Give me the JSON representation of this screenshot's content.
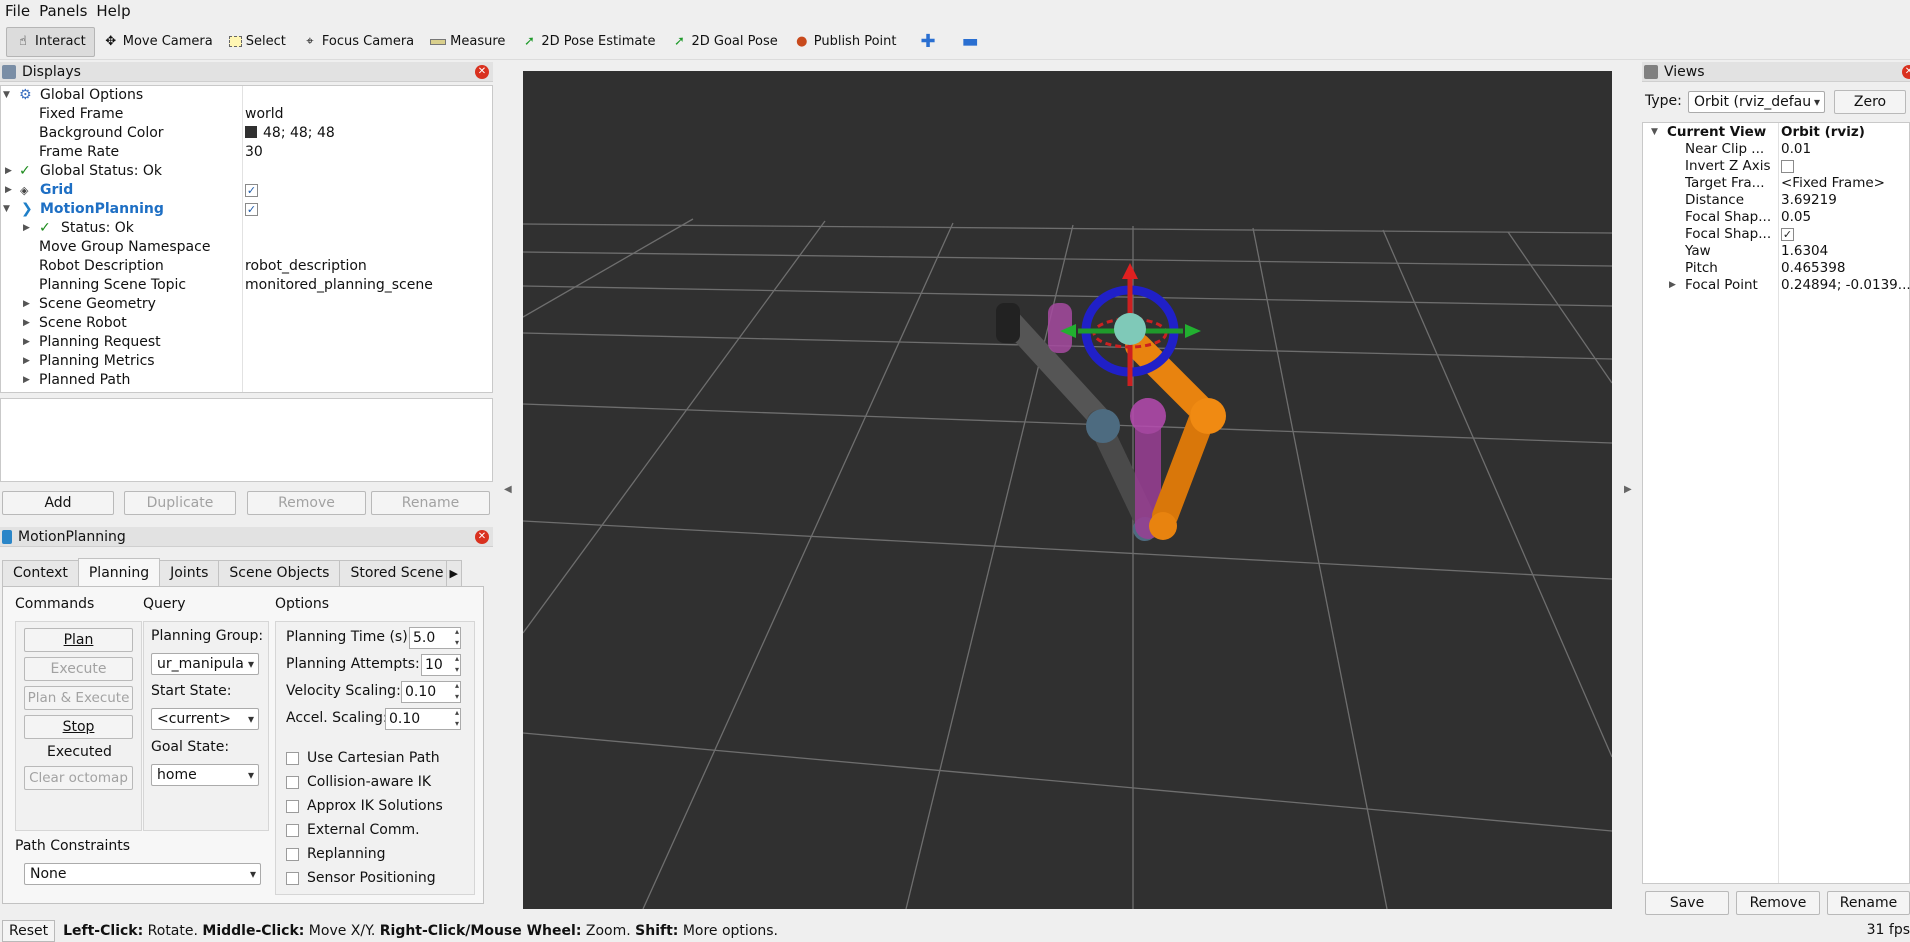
{
  "menu": {
    "file": "File",
    "panels": "Panels",
    "help": "Help"
  },
  "toolbar": {
    "interact": "Interact",
    "move_camera": "Move Camera",
    "select": "Select",
    "focus_camera": "Focus Camera",
    "measure": "Measure",
    "pose_estimate": "2D Pose Estimate",
    "goal_pose": "2D Goal Pose",
    "publish_point": "Publish Point"
  },
  "displays": {
    "title": "Displays",
    "rows": [
      {
        "label": "Global Options",
        "value": ""
      },
      {
        "label": "Fixed Frame",
        "value": "world"
      },
      {
        "label": "Background Color",
        "value": "48; 48; 48"
      },
      {
        "label": "Frame Rate",
        "value": "30"
      },
      {
        "label": "Global Status: Ok",
        "value": ""
      },
      {
        "label": "Grid",
        "value": ""
      },
      {
        "label": "MotionPlanning",
        "value": ""
      },
      {
        "label": "Status: Ok",
        "value": ""
      },
      {
        "label": "Move Group Namespace",
        "value": ""
      },
      {
        "label": "Robot Description",
        "value": "robot_description"
      },
      {
        "label": "Planning Scene Topic",
        "value": "monitored_planning_scene"
      },
      {
        "label": "Scene Geometry",
        "value": ""
      },
      {
        "label": "Scene Robot",
        "value": ""
      },
      {
        "label": "Planning Request",
        "value": ""
      },
      {
        "label": "Planning Metrics",
        "value": ""
      },
      {
        "label": "Planned Path",
        "value": ""
      }
    ],
    "buttons": {
      "add": "Add",
      "duplicate": "Duplicate",
      "remove": "Remove",
      "rename": "Rename"
    }
  },
  "motion_planning": {
    "title": "MotionPlanning",
    "tabs": [
      "Context",
      "Planning",
      "Joints",
      "Scene Objects",
      "Stored Scene"
    ],
    "commands": {
      "heading": "Commands",
      "plan": "Plan",
      "execute": "Execute",
      "plan_execute": "Plan & Execute",
      "stop": "Stop",
      "status": "Executed",
      "clear_octomap": "Clear octomap"
    },
    "query": {
      "heading": "Query",
      "planning_group_label": "Planning Group:",
      "planning_group": "ur_manipula",
      "start_state_label": "Start State:",
      "start_state": "<current>",
      "goal_state_label": "Goal State:",
      "goal_state": "home"
    },
    "options": {
      "heading": "Options",
      "planning_time_label": "Planning Time (s):",
      "planning_time": "5.0",
      "planning_attempts_label": "Planning Attempts:",
      "planning_attempts": "10",
      "velocity_scaling_label": "Velocity Scaling:",
      "velocity_scaling": "0.10",
      "accel_scaling_label": "Accel. Scaling:",
      "accel_scaling": "0.10",
      "checks": [
        "Use Cartesian Path",
        "Collision-aware IK",
        "Approx IK Solutions",
        "External Comm.",
        "Replanning",
        "Sensor Positioning"
      ]
    },
    "path_constraints": {
      "label": "Path Constraints",
      "value": "None"
    }
  },
  "views": {
    "title": "Views",
    "type_label": "Type:",
    "type_value": "Orbit (rviz_defau",
    "zero": "Zero",
    "rows": [
      {
        "label": "Current View",
        "value": "Orbit (rviz)"
      },
      {
        "label": "Near Clip ...",
        "value": "0.01"
      },
      {
        "label": "Invert Z Axis",
        "value": ""
      },
      {
        "label": "Target Fra...",
        "value": "<Fixed Frame>"
      },
      {
        "label": "Distance",
        "value": "3.69219"
      },
      {
        "label": "Focal Shap...",
        "value": "0.05"
      },
      {
        "label": "Focal Shap...",
        "value": ""
      },
      {
        "label": "Yaw",
        "value": "1.6304"
      },
      {
        "label": "Pitch",
        "value": "0.465398"
      },
      {
        "label": "Focal Point",
        "value": "0.24894; -0.0139..."
      }
    ],
    "buttons": {
      "save": "Save",
      "remove": "Remove",
      "rename": "Rename"
    }
  },
  "statusbar": {
    "reset": "Reset",
    "left_click": "Left-Click:",
    "left_click_action": " Rotate. ",
    "middle_click": "Middle-Click:",
    "middle_click_action": " Move X/Y. ",
    "right_click": "Right-Click/Mouse Wheel:",
    "right_click_action": " Zoom. ",
    "shift": "Shift:",
    "shift_action": " More options.",
    "fps": "31 fps"
  },
  "colors": {
    "viewport_bg": "#303030",
    "accent_blue": "#1e6fc4",
    "robot_orange": "#e8830f",
    "ghost_magenta": "#b64bb0"
  }
}
